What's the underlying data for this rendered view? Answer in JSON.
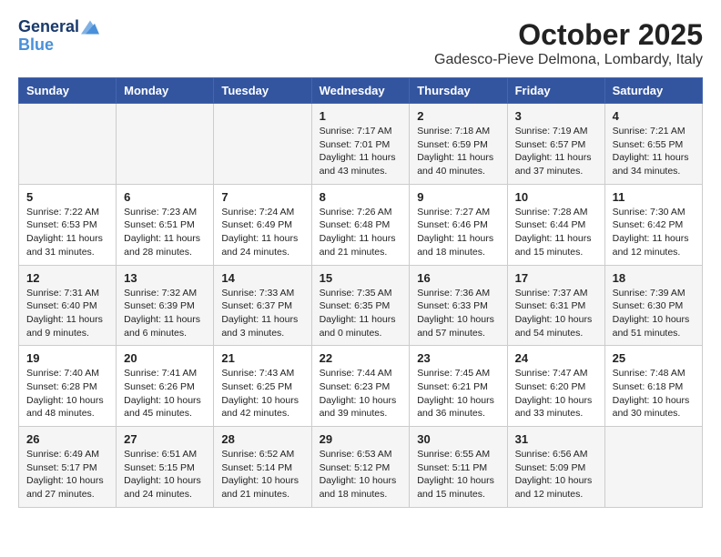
{
  "header": {
    "logo_line1": "General",
    "logo_line2": "Blue",
    "month": "October 2025",
    "location": "Gadesco-Pieve Delmona, Lombardy, Italy"
  },
  "weekdays": [
    "Sunday",
    "Monday",
    "Tuesday",
    "Wednesday",
    "Thursday",
    "Friday",
    "Saturday"
  ],
  "weeks": [
    [
      {
        "day": "",
        "info": ""
      },
      {
        "day": "",
        "info": ""
      },
      {
        "day": "",
        "info": ""
      },
      {
        "day": "1",
        "info": "Sunrise: 7:17 AM\nSunset: 7:01 PM\nDaylight: 11 hours\nand 43 minutes."
      },
      {
        "day": "2",
        "info": "Sunrise: 7:18 AM\nSunset: 6:59 PM\nDaylight: 11 hours\nand 40 minutes."
      },
      {
        "day": "3",
        "info": "Sunrise: 7:19 AM\nSunset: 6:57 PM\nDaylight: 11 hours\nand 37 minutes."
      },
      {
        "day": "4",
        "info": "Sunrise: 7:21 AM\nSunset: 6:55 PM\nDaylight: 11 hours\nand 34 minutes."
      }
    ],
    [
      {
        "day": "5",
        "info": "Sunrise: 7:22 AM\nSunset: 6:53 PM\nDaylight: 11 hours\nand 31 minutes."
      },
      {
        "day": "6",
        "info": "Sunrise: 7:23 AM\nSunset: 6:51 PM\nDaylight: 11 hours\nand 28 minutes."
      },
      {
        "day": "7",
        "info": "Sunrise: 7:24 AM\nSunset: 6:49 PM\nDaylight: 11 hours\nand 24 minutes."
      },
      {
        "day": "8",
        "info": "Sunrise: 7:26 AM\nSunset: 6:48 PM\nDaylight: 11 hours\nand 21 minutes."
      },
      {
        "day": "9",
        "info": "Sunrise: 7:27 AM\nSunset: 6:46 PM\nDaylight: 11 hours\nand 18 minutes."
      },
      {
        "day": "10",
        "info": "Sunrise: 7:28 AM\nSunset: 6:44 PM\nDaylight: 11 hours\nand 15 minutes."
      },
      {
        "day": "11",
        "info": "Sunrise: 7:30 AM\nSunset: 6:42 PM\nDaylight: 11 hours\nand 12 minutes."
      }
    ],
    [
      {
        "day": "12",
        "info": "Sunrise: 7:31 AM\nSunset: 6:40 PM\nDaylight: 11 hours\nand 9 minutes."
      },
      {
        "day": "13",
        "info": "Sunrise: 7:32 AM\nSunset: 6:39 PM\nDaylight: 11 hours\nand 6 minutes."
      },
      {
        "day": "14",
        "info": "Sunrise: 7:33 AM\nSunset: 6:37 PM\nDaylight: 11 hours\nand 3 minutes."
      },
      {
        "day": "15",
        "info": "Sunrise: 7:35 AM\nSunset: 6:35 PM\nDaylight: 11 hours\nand 0 minutes."
      },
      {
        "day": "16",
        "info": "Sunrise: 7:36 AM\nSunset: 6:33 PM\nDaylight: 10 hours\nand 57 minutes."
      },
      {
        "day": "17",
        "info": "Sunrise: 7:37 AM\nSunset: 6:31 PM\nDaylight: 10 hours\nand 54 minutes."
      },
      {
        "day": "18",
        "info": "Sunrise: 7:39 AM\nSunset: 6:30 PM\nDaylight: 10 hours\nand 51 minutes."
      }
    ],
    [
      {
        "day": "19",
        "info": "Sunrise: 7:40 AM\nSunset: 6:28 PM\nDaylight: 10 hours\nand 48 minutes."
      },
      {
        "day": "20",
        "info": "Sunrise: 7:41 AM\nSunset: 6:26 PM\nDaylight: 10 hours\nand 45 minutes."
      },
      {
        "day": "21",
        "info": "Sunrise: 7:43 AM\nSunset: 6:25 PM\nDaylight: 10 hours\nand 42 minutes."
      },
      {
        "day": "22",
        "info": "Sunrise: 7:44 AM\nSunset: 6:23 PM\nDaylight: 10 hours\nand 39 minutes."
      },
      {
        "day": "23",
        "info": "Sunrise: 7:45 AM\nSunset: 6:21 PM\nDaylight: 10 hours\nand 36 minutes."
      },
      {
        "day": "24",
        "info": "Sunrise: 7:47 AM\nSunset: 6:20 PM\nDaylight: 10 hours\nand 33 minutes."
      },
      {
        "day": "25",
        "info": "Sunrise: 7:48 AM\nSunset: 6:18 PM\nDaylight: 10 hours\nand 30 minutes."
      }
    ],
    [
      {
        "day": "26",
        "info": "Sunrise: 6:49 AM\nSunset: 5:17 PM\nDaylight: 10 hours\nand 27 minutes."
      },
      {
        "day": "27",
        "info": "Sunrise: 6:51 AM\nSunset: 5:15 PM\nDaylight: 10 hours\nand 24 minutes."
      },
      {
        "day": "28",
        "info": "Sunrise: 6:52 AM\nSunset: 5:14 PM\nDaylight: 10 hours\nand 21 minutes."
      },
      {
        "day": "29",
        "info": "Sunrise: 6:53 AM\nSunset: 5:12 PM\nDaylight: 10 hours\nand 18 minutes."
      },
      {
        "day": "30",
        "info": "Sunrise: 6:55 AM\nSunset: 5:11 PM\nDaylight: 10 hours\nand 15 minutes."
      },
      {
        "day": "31",
        "info": "Sunrise: 6:56 AM\nSunset: 5:09 PM\nDaylight: 10 hours\nand 12 minutes."
      },
      {
        "day": "",
        "info": ""
      }
    ]
  ]
}
